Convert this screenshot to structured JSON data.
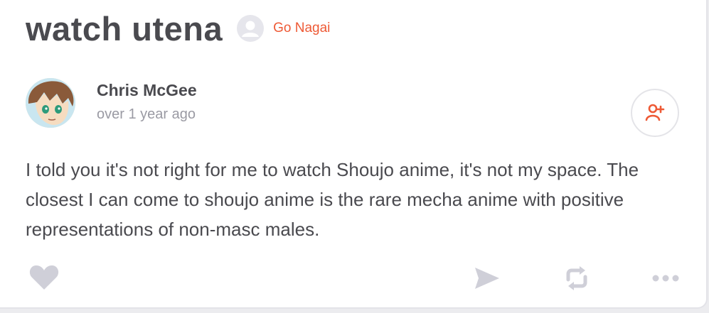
{
  "post": {
    "title": "watch utena",
    "tag": "Go Nagai"
  },
  "author": {
    "name": "Chris McGee",
    "timestamp": "over 1 year ago"
  },
  "body": "I told you it's not right for me to watch Shoujo anime, it's not my space. The closest I can come to shoujo anime is the rare mecha anime with positive representations of non-masc males.",
  "icons": {
    "follow": "add-user-icon",
    "like": "heart-icon",
    "share": "send-icon",
    "repost": "repost-icon",
    "more": "more-icon"
  },
  "colors": {
    "accent": "#ee5a36",
    "text": "#4a4a4f",
    "muted": "#9a9aa3",
    "icon": "#cfcfd8"
  }
}
